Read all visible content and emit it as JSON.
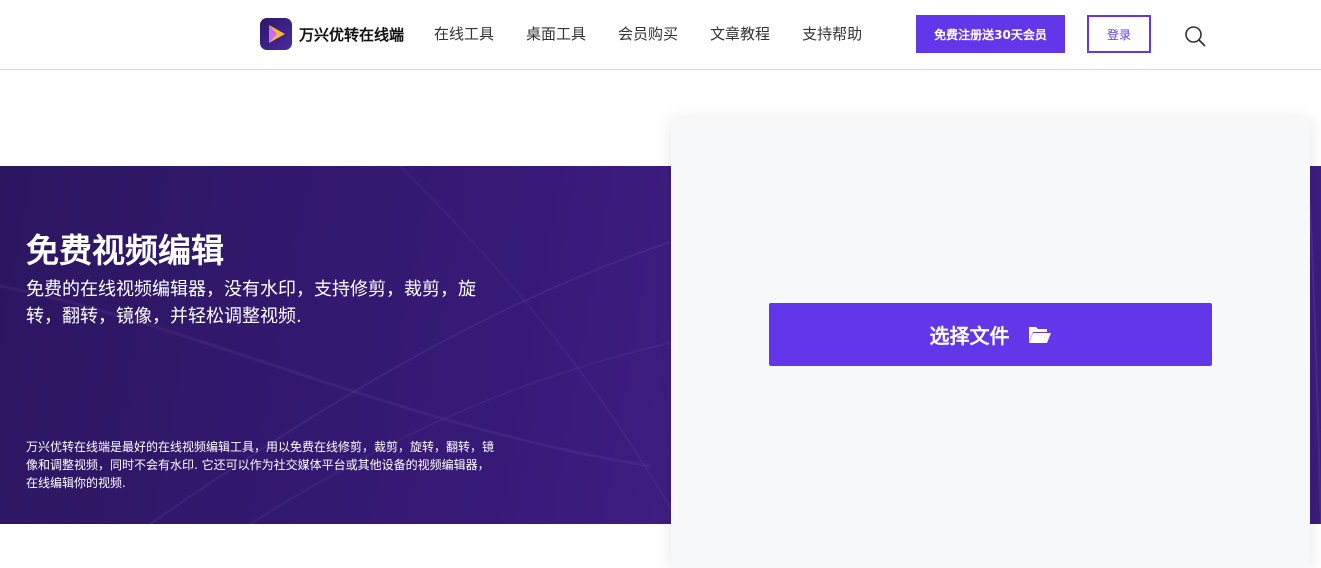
{
  "header": {
    "brand": "万兴优转在线端",
    "nav": [
      {
        "label": "在线工具"
      },
      {
        "label": "桌面工具"
      },
      {
        "label": "会员购买"
      },
      {
        "label": "文章教程"
      },
      {
        "label": "支持帮助"
      }
    ],
    "register_label": "免费注册送30天会员",
    "login_label": "登录",
    "search_icon": "search-icon"
  },
  "hero": {
    "title": "免费视频编辑",
    "subtitle": "免费的在线视频编辑器，没有水印，支持修剪，裁剪，旋转，翻转，镜像，并轻松调整视频.",
    "description": "万兴优转在线端是最好的在线视频编辑工具，用以免费在线修剪，裁剪，旋转，翻转，镜像和调整视频，同时不会有水印. 它还可以作为社交媒体平台或其他设备的视频编辑器，在线编辑你的视频."
  },
  "upload": {
    "button_label": "选择文件",
    "button_icon": "folder-open-icon"
  },
  "colors": {
    "accent": "#6236e9",
    "hero_bg": "#371a78",
    "card_bg": "#f7f8fa"
  }
}
